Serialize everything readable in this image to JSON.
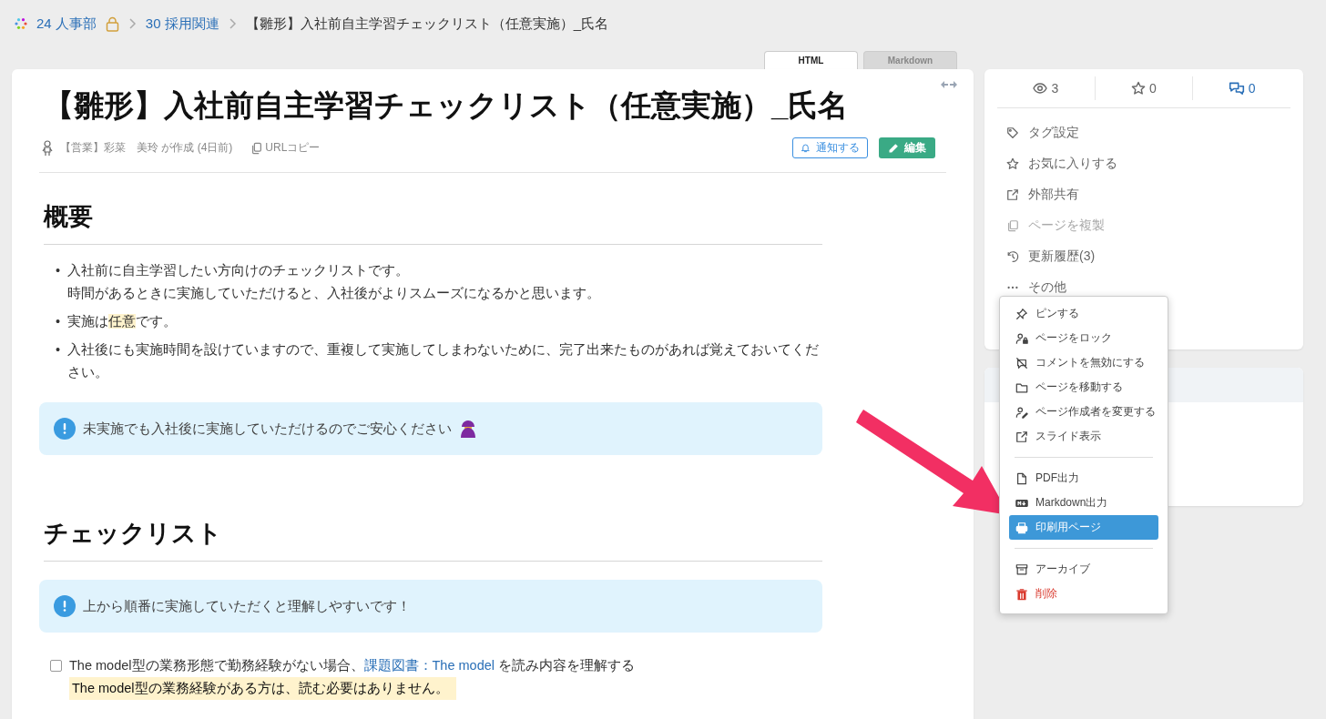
{
  "breadcrumb": [
    {
      "label": "24 人事部",
      "locked": true
    },
    {
      "label": "30 採用関連"
    },
    {
      "label": "【雛形】入社前自主学習チェックリスト（任意実施）_氏名"
    }
  ],
  "view_tabs": [
    {
      "label": "HTML",
      "selected": true
    },
    {
      "label": "Markdown",
      "selected": false
    }
  ],
  "page": {
    "title": "【雛形】入社前自主学習チェックリスト（任意実施）_氏名",
    "author": "【営業】彩菜　美玲 が作成 (4日前)",
    "copy_url": "URLコピー",
    "notify_button": "通知する",
    "edit_button": "編集",
    "sections": [
      {
        "heading": "概要",
        "bullets": [
          {
            "marker": "•",
            "segments": [
              {
                "kind": "plain",
                "text": "入社前に自主学習したい方向けのチェックリストです。"
              },
              {
                "kind": "break"
              },
              {
                "kind": "plain",
                "text": "時間があるときに実施していただけると、入社後がよりスムーズになるかと思います。"
              }
            ]
          },
          {
            "marker": "•",
            "segments": [
              {
                "kind": "plain",
                "text": "実施は"
              },
              {
                "kind": "highlight",
                "text": "任意"
              },
              {
                "kind": "plain",
                "text": "です。"
              }
            ]
          },
          {
            "marker": "•",
            "segments": [
              {
                "kind": "plain",
                "text": "入社後にも実施時間を設けていますので、重複して実施してしまわないために、完了出来たものがあれば覚えておいてください。"
              }
            ]
          }
        ],
        "notice": "未実施でも入社後に実施していただけるのでご安心ください"
      },
      {
        "heading": "チェックリスト",
        "notice": "上から順番に実施していただくと理解しやすいです！",
        "tasks": [
          {
            "checked": false,
            "segments": [
              {
                "kind": "plain",
                "text": "The model型の業務形態で勤務経験がない場合、"
              },
              {
                "kind": "link",
                "text": "課題図書：The model"
              },
              {
                "kind": "plain",
                "text": " を読み内容を理解する"
              }
            ],
            "note": "The model型の業務経験がある方は、読む必要はありません。"
          }
        ]
      }
    ]
  },
  "stats": [
    {
      "value": "3",
      "highlighted": false
    },
    {
      "value": "0",
      "highlighted": false
    },
    {
      "value": "0",
      "highlighted": true
    }
  ],
  "side_actions": [
    {
      "label": "タグ設定",
      "disabled": false
    },
    {
      "label": "お気に入りする",
      "disabled": false
    },
    {
      "label": "外部共有",
      "disabled": false
    },
    {
      "label": "ページを複製",
      "disabled": true
    },
    {
      "label": "更新履歴(3)",
      "disabled": false
    },
    {
      "label": "その他",
      "disabled": false
    }
  ],
  "more_menu": [
    [
      {
        "label": "ピンする",
        "kind": "normal",
        "selected": false
      },
      {
        "label": "ページをロック",
        "kind": "normal",
        "selected": false
      },
      {
        "label": "コメントを無効にする",
        "kind": "normal",
        "selected": false
      },
      {
        "label": "ページを移動する",
        "kind": "normal",
        "selected": false
      },
      {
        "label": "ページ作成者を変更する",
        "kind": "normal",
        "selected": false
      },
      {
        "label": "スライド表示",
        "kind": "normal",
        "selected": false
      }
    ],
    [
      {
        "label": "PDF出力",
        "kind": "normal",
        "selected": false
      },
      {
        "label": "Markdown出力",
        "kind": "normal",
        "selected": false
      },
      {
        "label": "印刷用ページ",
        "kind": "normal",
        "selected": true
      }
    ],
    [
      {
        "label": "アーカイブ",
        "kind": "normal",
        "selected": false
      },
      {
        "label": "削除",
        "kind": "danger",
        "selected": false
      }
    ]
  ]
}
